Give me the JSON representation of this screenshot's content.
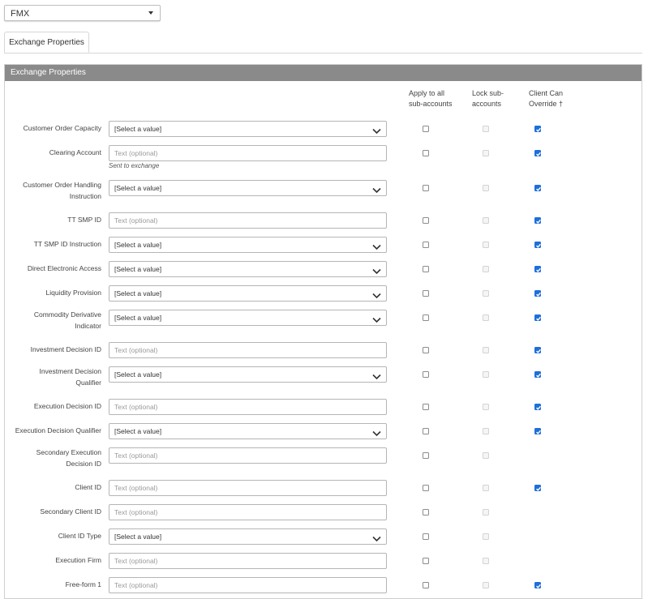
{
  "venue_select": {
    "value": "FMX",
    "caret_icon": "caret-down-icon"
  },
  "tabs": [
    {
      "label": "Exchange Properties",
      "active": true
    }
  ],
  "panel": {
    "title": "Exchange Properties"
  },
  "columns": {
    "apply": [
      "Apply to all",
      "sub-accounts"
    ],
    "lock": [
      "Lock sub-",
      "accounts"
    ],
    "client": [
      "Client Can",
      "Override †"
    ]
  },
  "colors": {
    "header_bg": "#8a8a8a",
    "checkbox_checked": "#1e6fd9"
  },
  "rows": [
    {
      "label": [
        "Customer Order Capacity"
      ],
      "type": "select",
      "value": "[Select a value]",
      "client_override": true
    },
    {
      "label": [
        "Clearing Account"
      ],
      "type": "text",
      "value": "Text (optional)",
      "hint": "Sent to exchange",
      "client_override": true
    },
    {
      "label": [
        "Customer Order Handling",
        "Instruction"
      ],
      "type": "select",
      "value": "[Select a value]",
      "client_override": true
    },
    {
      "label": [
        "TT SMP ID"
      ],
      "type": "text",
      "value": "Text (optional)",
      "client_override": true
    },
    {
      "label": [
        "TT SMP ID Instruction"
      ],
      "type": "select",
      "value": "[Select a value]",
      "client_override": true
    },
    {
      "label": [
        "Direct Electronic Access"
      ],
      "type": "select",
      "value": "[Select a value]",
      "client_override": true
    },
    {
      "label": [
        "Liquidity Provision"
      ],
      "type": "select",
      "value": "[Select a value]",
      "client_override": true
    },
    {
      "label": [
        "Commodity Derivative",
        "Indicator"
      ],
      "type": "select",
      "value": "[Select a value]",
      "client_override": true
    },
    {
      "label": [
        "Investment Decision ID"
      ],
      "type": "text",
      "value": "Text (optional)",
      "client_override": true
    },
    {
      "label": [
        "Investment Decision",
        "Qualifier"
      ],
      "type": "select",
      "value": "[Select a value]",
      "client_override": true
    },
    {
      "label": [
        "Execution Decision ID"
      ],
      "type": "text",
      "value": "Text (optional)",
      "client_override": true
    },
    {
      "label": [
        "Execution Decision Qualifier"
      ],
      "type": "select",
      "value": "[Select a value]",
      "client_override": true
    },
    {
      "label": [
        "Secondary Execution",
        "Decision ID"
      ],
      "type": "text",
      "value": "Text (optional)",
      "client_override": null
    },
    {
      "label": [
        "Client ID"
      ],
      "type": "text",
      "value": "Text (optional)",
      "client_override": true
    },
    {
      "label": [
        "Secondary Client ID"
      ],
      "type": "text",
      "value": "Text (optional)",
      "client_override": null
    },
    {
      "label": [
        "Client ID Type"
      ],
      "type": "select",
      "value": "[Select a value]",
      "client_override": null
    },
    {
      "label": [
        "Execution Firm"
      ],
      "type": "text",
      "value": "Text (optional)",
      "client_override": null
    },
    {
      "label": [
        "Free-form 1"
      ],
      "type": "text",
      "value": "Text (optional)",
      "client_override": true
    }
  ]
}
